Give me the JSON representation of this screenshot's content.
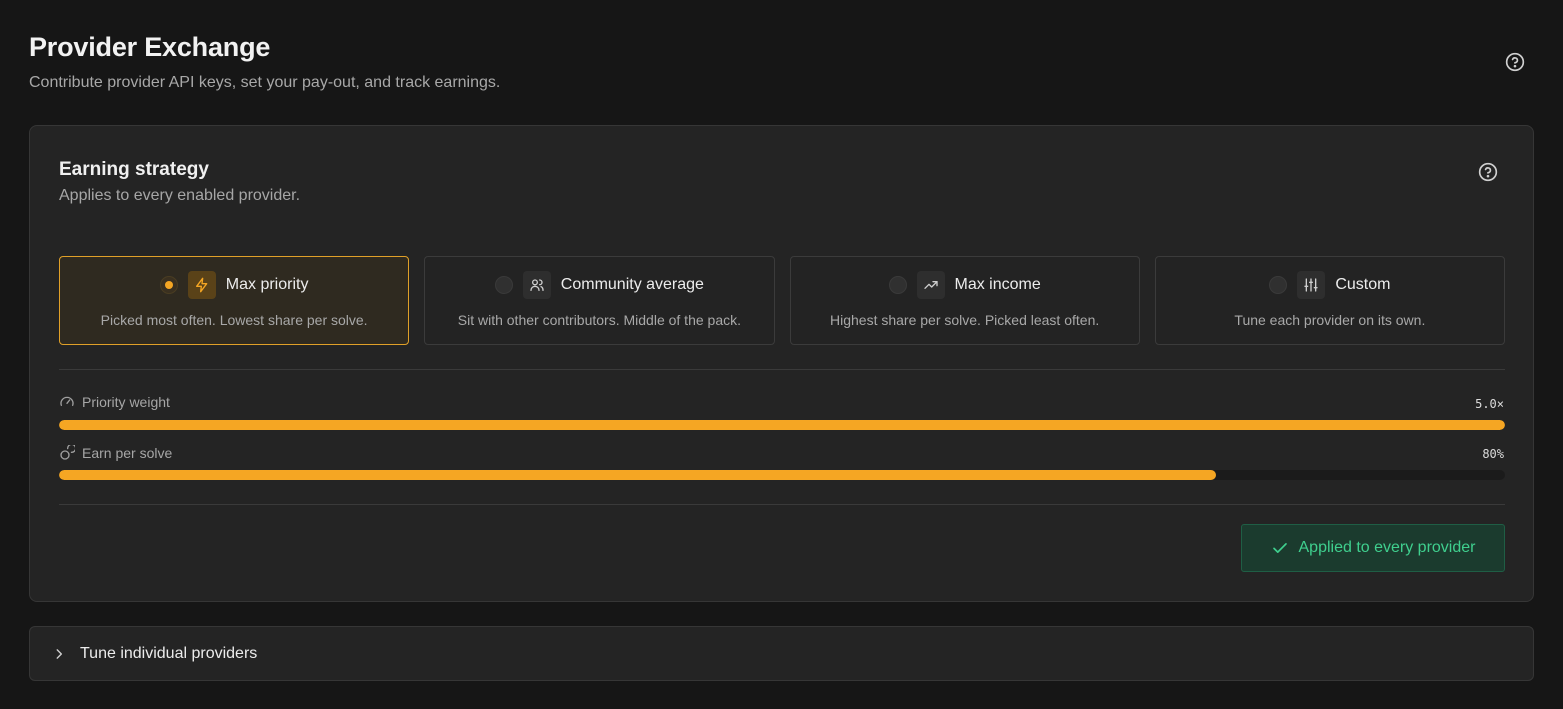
{
  "header": {
    "title": "Provider Exchange",
    "subtitle": "Contribute provider API keys, set your pay-out, and track earnings.",
    "help_icon": "help-circle-icon"
  },
  "strategy": {
    "title": "Earning strategy",
    "subtitle": "Applies to every enabled provider.",
    "options": [
      {
        "label": "Max priority",
        "description": "Picked most often. Lowest share per solve.",
        "icon": "lightning-icon",
        "selected": true
      },
      {
        "label": "Community average",
        "description": "Sit with other contributors. Middle of the pack.",
        "icon": "users-icon",
        "selected": false
      },
      {
        "label": "Max income",
        "description": "Highest share per solve. Picked least often.",
        "icon": "trending-up-icon",
        "selected": false
      },
      {
        "label": "Custom",
        "description": "Tune each provider on its own.",
        "icon": "sliders-icon",
        "selected": false
      }
    ],
    "sliders": [
      {
        "label": "Priority weight",
        "value_text": "5.0×",
        "fraction": 1.0,
        "icon": "gauge-icon"
      },
      {
        "label": "Earn per solve",
        "value_text": "80%",
        "fraction": 0.8,
        "icon": "coins-icon"
      }
    ],
    "applied_label": "Applied to every provider",
    "accent_color": "#f5a623",
    "success_color": "#3fcf8e"
  },
  "tune": {
    "label": "Tune individual providers"
  }
}
